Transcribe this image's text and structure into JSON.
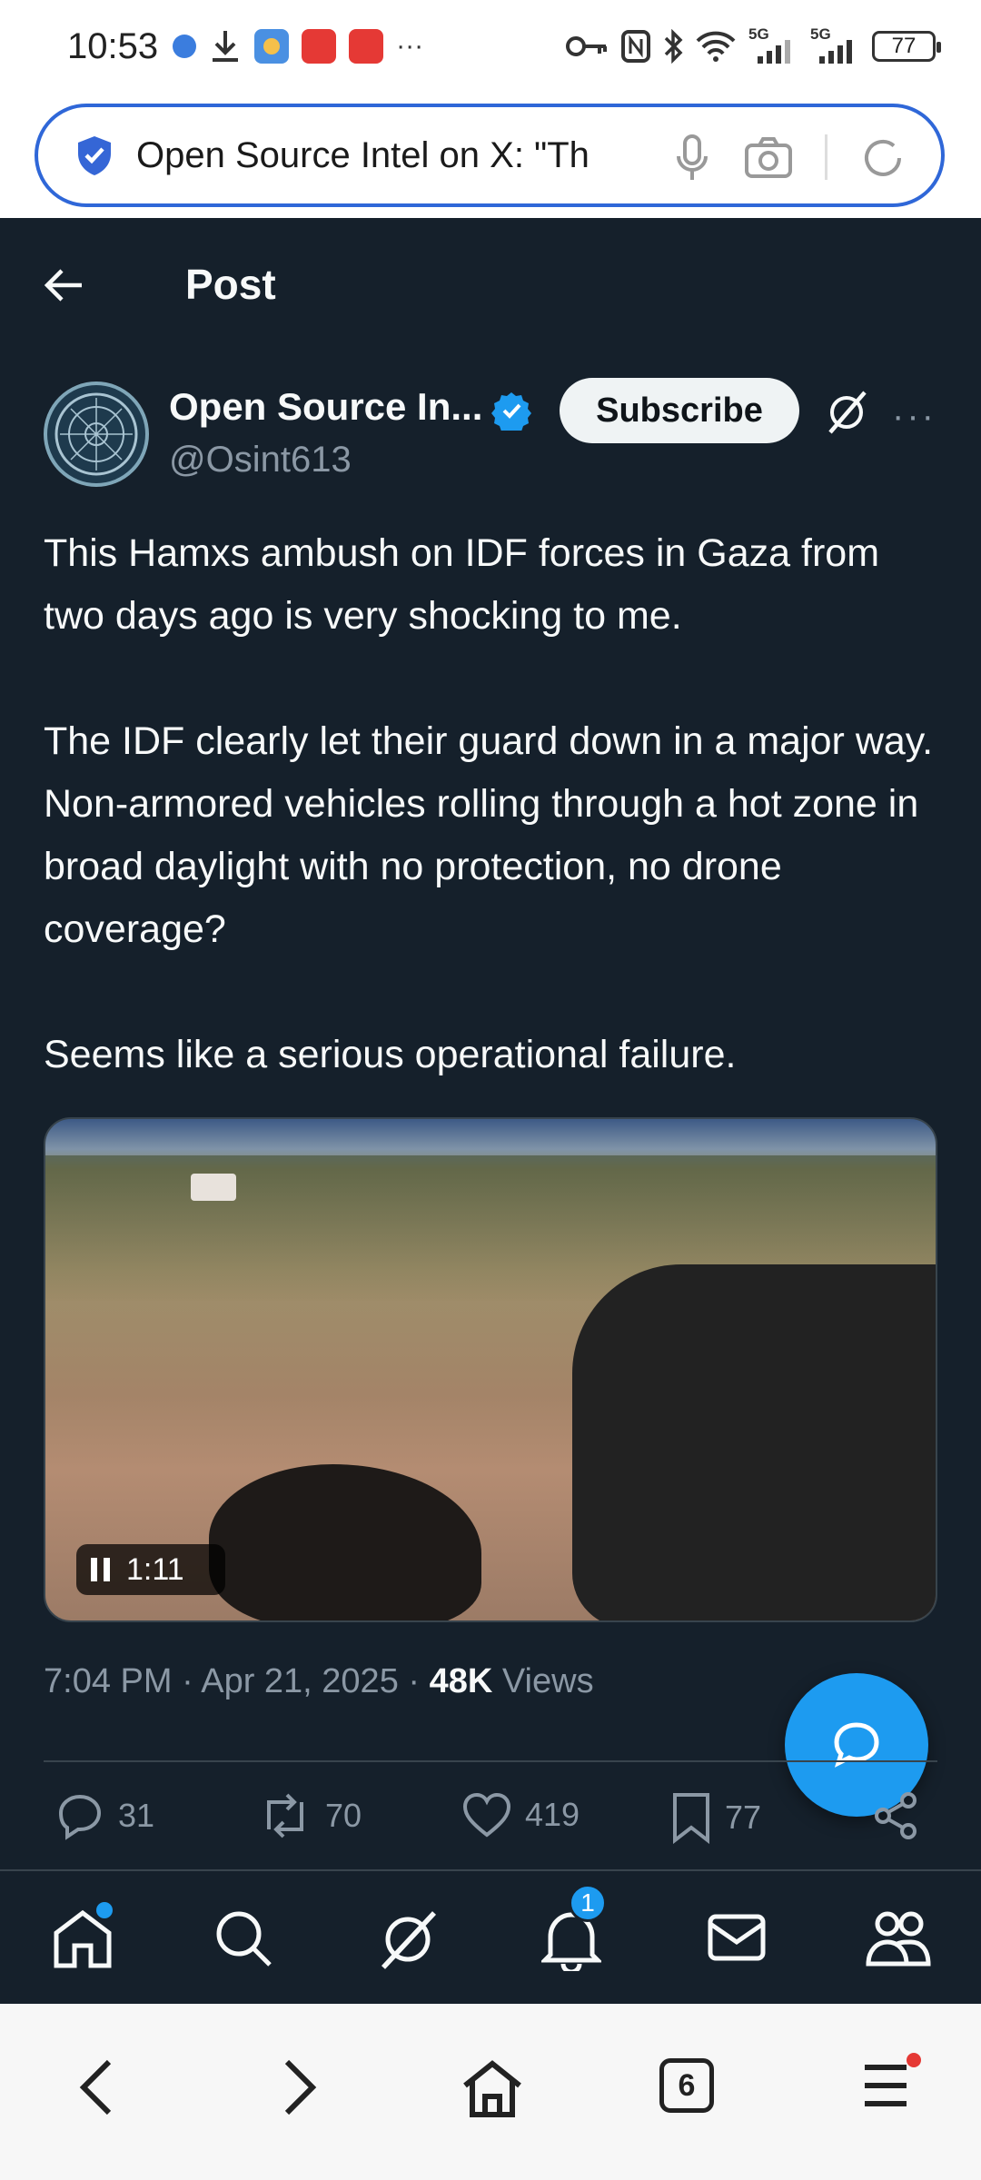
{
  "status_bar": {
    "time": "10:53",
    "battery": "77",
    "more": "···",
    "network_1": "5G",
    "network_2": "5G"
  },
  "browser": {
    "url_text": "Open Source Intel on X: \"Th"
  },
  "post_header": {
    "title": "Post"
  },
  "author": {
    "name": "Open Source In...",
    "handle": "@Osint613",
    "subscribe_label": "Subscribe"
  },
  "post": {
    "text": "This Hamxs ambush on IDF forces in Gaza from two days ago is very shocking to me.\n\nThe IDF clearly let their guard down in a major way. Non-armored vehicles rolling through a hot zone in broad daylight with no protection, no drone coverage?\n\nSeems like a serious operational failure.",
    "video_duration": "1:11",
    "time": "7:04 PM",
    "date": "Apr 21, 2025",
    "views_count": "48K",
    "views_label": "Views",
    "sep": "·"
  },
  "actions": {
    "replies": "31",
    "reposts": "70",
    "likes": "419",
    "bookmarks": "77"
  },
  "tabbar": {
    "notifications_badge": "1"
  },
  "navbar": {
    "tab_count": "6"
  },
  "colors": {
    "background": "#15202b",
    "accent": "#1d9bf0",
    "muted": "#8b98a5",
    "url_border": "#2f67d8"
  }
}
